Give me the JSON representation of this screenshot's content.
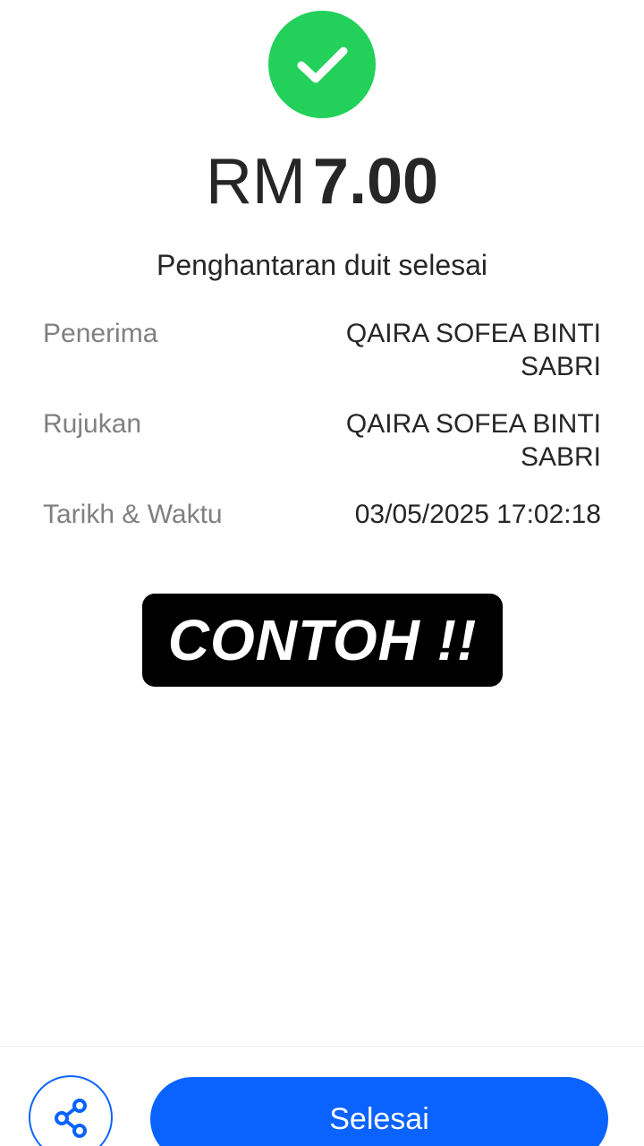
{
  "receipt": {
    "currency": "RM",
    "amount": "7.00",
    "status_title": "Penghantaran duit selesai",
    "status_icon": "check-icon"
  },
  "details": [
    {
      "label": "Penerima",
      "value": "QAIRA SOFEA BINTI SABRI"
    },
    {
      "label": "Rujukan",
      "value": "QAIRA SOFEA BINTI SABRI"
    },
    {
      "label": "Tarikh & Waktu",
      "value": "03/05/2025 17:02:18"
    }
  ],
  "watermark": {
    "text": "CONTOH !!"
  },
  "footer": {
    "share_icon": "share-icon",
    "done_label": "Selesai"
  },
  "colors": {
    "success": "#22d05a",
    "primary": "#0a63ff",
    "label_gray": "#808080",
    "text_dark": "#262626"
  }
}
